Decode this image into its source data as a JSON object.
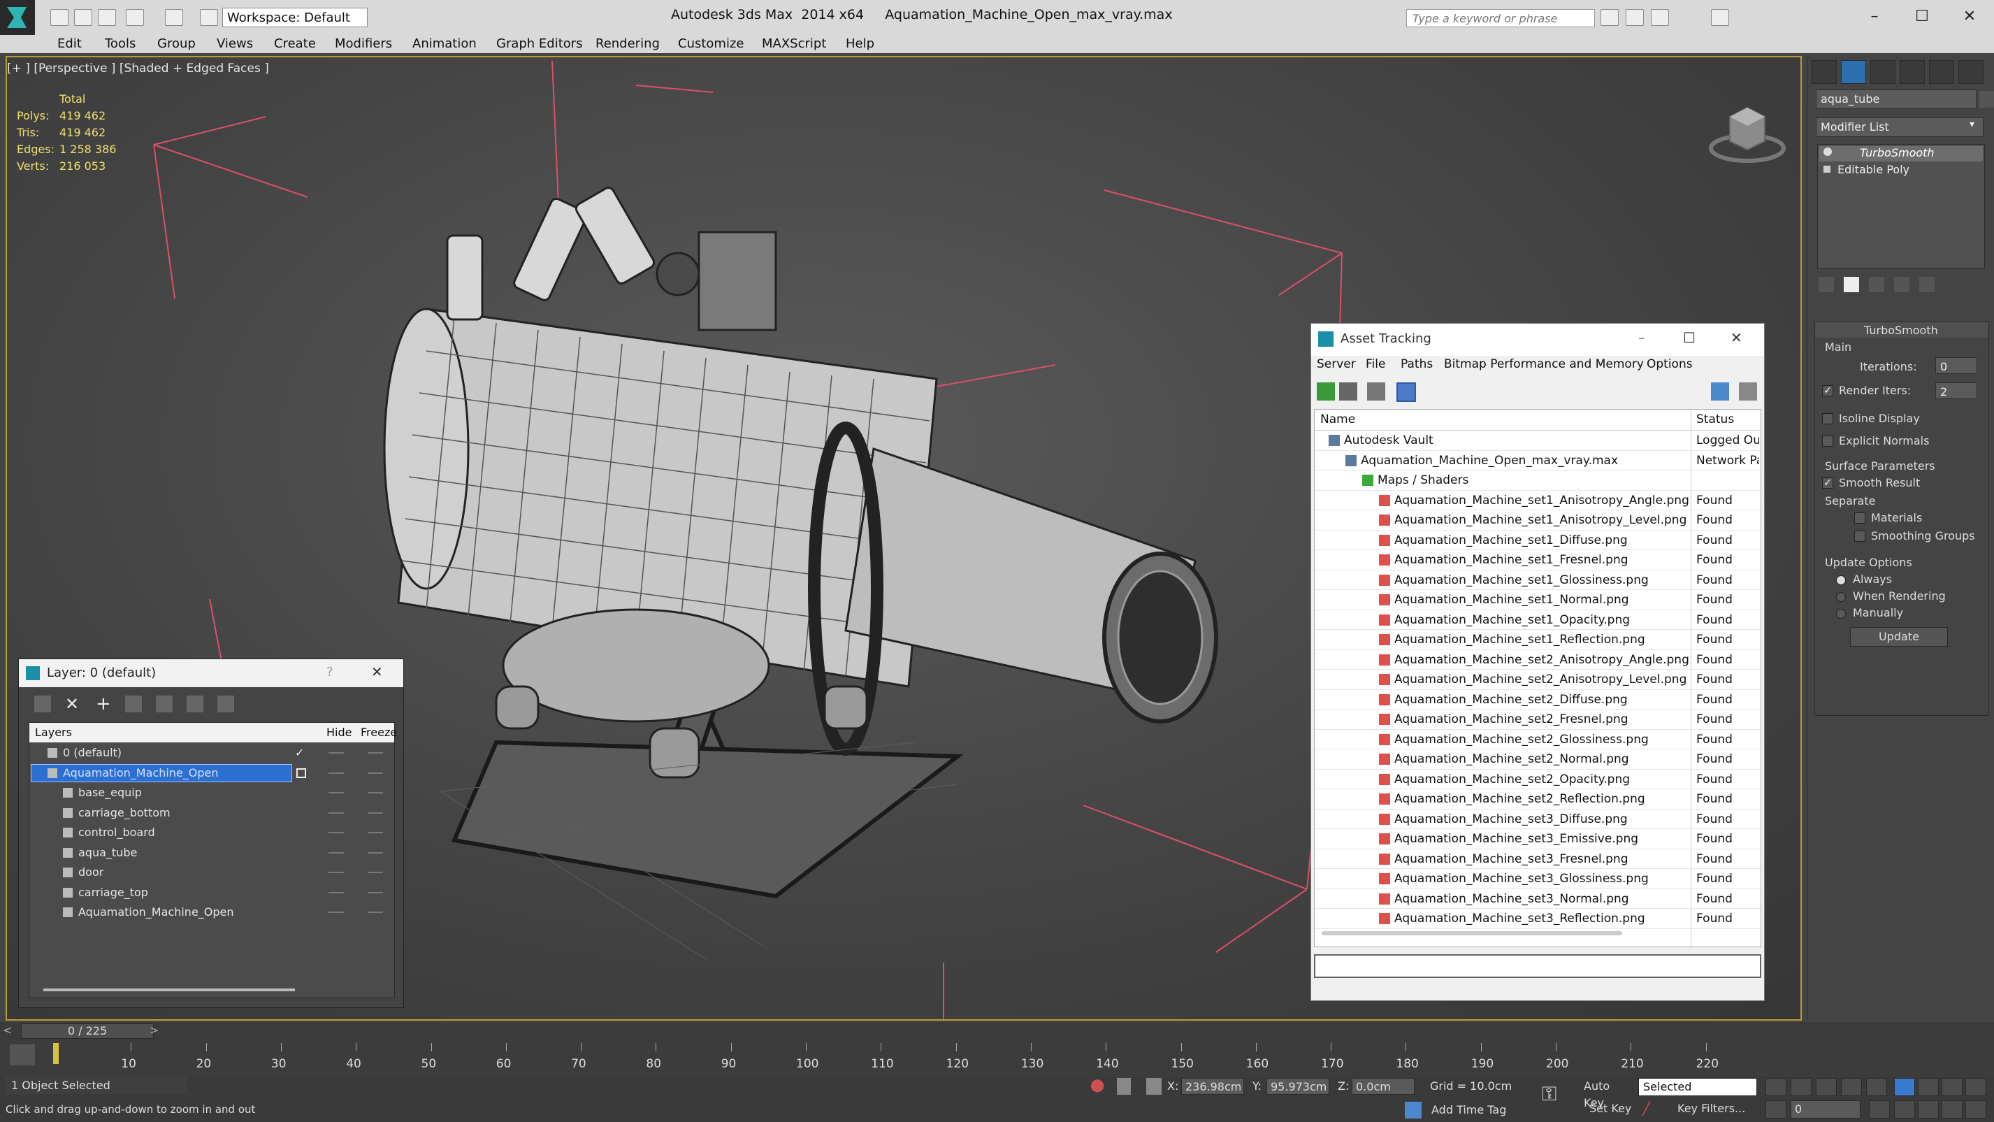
{
  "titlebar": {
    "app_title": "Autodesk 3ds Max  2014 x64     Aquamation_Machine_Open_max_vray.max",
    "workspace": "Workspace: Default",
    "search_placeholder": "Type a keyword or phrase",
    "minimize": "–",
    "maximize": "☐",
    "close": "✕"
  },
  "menu": [
    "Edit",
    "Tools",
    "Group",
    "Views",
    "Create",
    "Modifiers",
    "Animation",
    "Graph Editors",
    "Rendering",
    "Customize",
    "MAXScript",
    "Help"
  ],
  "viewport": {
    "label": "[+ ] [Perspective ] [Shaded + Edged Faces ]",
    "stats": {
      "header": "Total",
      "polys_label": "Polys:",
      "polys": "419 462",
      "tris_label": "Tris:",
      "tris": "419 462",
      "edges_label": "Edges:",
      "edges": "1 258 386",
      "verts_label": "Verts:",
      "verts": "216 053"
    }
  },
  "command_panel": {
    "object_name": "aqua_tube",
    "modifier_list": "Modifier List",
    "stack": [
      "TurboSmooth",
      "Editable Poly"
    ],
    "rollout_title": "TurboSmooth",
    "main_label": "Main",
    "iterations_label": "Iterations:",
    "iterations": "0",
    "render_iters_label": "Render Iters:",
    "render_iters": "2",
    "isoline_display": "Isoline Display",
    "explicit_normals": "Explicit Normals",
    "surface_parameters": "Surface Parameters",
    "smooth_result": "Smooth Result",
    "separate_label": "Separate",
    "materials": "Materials",
    "smoothing_groups": "Smoothing Groups",
    "update_options": "Update Options",
    "always": "Always",
    "when_rendering": "When Rendering",
    "manually": "Manually",
    "update_button": "Update"
  },
  "asset_tracking": {
    "title": "Asset Tracking",
    "menu": [
      "Server",
      "File",
      "Paths",
      "Bitmap Performance and Memory",
      "Options"
    ],
    "col_name": "Name",
    "col_status": "Status",
    "rows": [
      {
        "name": "Autodesk Vault",
        "status": "Logged Out",
        "indent": 0
      },
      {
        "name": "Aquamation_Machine_Open_max_vray.max",
        "status": "Network Pa",
        "indent": 1
      },
      {
        "name": "Maps / Shaders",
        "status": "",
        "indent": 2
      },
      {
        "name": "Aquamation_Machine_set1_Anisotropy_Angle.png",
        "status": "Found",
        "indent": 3
      },
      {
        "name": "Aquamation_Machine_set1_Anisotropy_Level.png",
        "status": "Found",
        "indent": 3
      },
      {
        "name": "Aquamation_Machine_set1_Diffuse.png",
        "status": "Found",
        "indent": 3
      },
      {
        "name": "Aquamation_Machine_set1_Fresnel.png",
        "status": "Found",
        "indent": 3
      },
      {
        "name": "Aquamation_Machine_set1_Glossiness.png",
        "status": "Found",
        "indent": 3
      },
      {
        "name": "Aquamation_Machine_set1_Normal.png",
        "status": "Found",
        "indent": 3
      },
      {
        "name": "Aquamation_Machine_set1_Opacity.png",
        "status": "Found",
        "indent": 3
      },
      {
        "name": "Aquamation_Machine_set1_Reflection.png",
        "status": "Found",
        "indent": 3
      },
      {
        "name": "Aquamation_Machine_set2_Anisotropy_Angle.png",
        "status": "Found",
        "indent": 3
      },
      {
        "name": "Aquamation_Machine_set2_Anisotropy_Level.png",
        "status": "Found",
        "indent": 3
      },
      {
        "name": "Aquamation_Machine_set2_Diffuse.png",
        "status": "Found",
        "indent": 3
      },
      {
        "name": "Aquamation_Machine_set2_Fresnel.png",
        "status": "Found",
        "indent": 3
      },
      {
        "name": "Aquamation_Machine_set2_Glossiness.png",
        "status": "Found",
        "indent": 3
      },
      {
        "name": "Aquamation_Machine_set2_Normal.png",
        "status": "Found",
        "indent": 3
      },
      {
        "name": "Aquamation_Machine_set2_Opacity.png",
        "status": "Found",
        "indent": 3
      },
      {
        "name": "Aquamation_Machine_set2_Reflection.png",
        "status": "Found",
        "indent": 3
      },
      {
        "name": "Aquamation_Machine_set3_Diffuse.png",
        "status": "Found",
        "indent": 3
      },
      {
        "name": "Aquamation_Machine_set3_Emissive.png",
        "status": "Found",
        "indent": 3
      },
      {
        "name": "Aquamation_Machine_set3_Fresnel.png",
        "status": "Found",
        "indent": 3
      },
      {
        "name": "Aquamation_Machine_set3_Glossiness.png",
        "status": "Found",
        "indent": 3
      },
      {
        "name": "Aquamation_Machine_set3_Normal.png",
        "status": "Found",
        "indent": 3
      },
      {
        "name": "Aquamation_Machine_set3_Reflection.png",
        "status": "Found",
        "indent": 3
      }
    ]
  },
  "layer_window": {
    "title": "Layer: 0 (default)",
    "help": "?",
    "close": "✕",
    "col_layers": "Layers",
    "col_hide": "Hide",
    "col_freeze": "Freeze",
    "rows": [
      {
        "name": "0 (default)",
        "indent": 0,
        "selected": false
      },
      {
        "name": "Aquamation_Machine_Open",
        "indent": 0,
        "selected": true
      },
      {
        "name": "base_equip",
        "indent": 1,
        "selected": false
      },
      {
        "name": "carriage_bottom",
        "indent": 1,
        "selected": false
      },
      {
        "name": "control_board",
        "indent": 1,
        "selected": false
      },
      {
        "name": "aqua_tube",
        "indent": 1,
        "selected": false
      },
      {
        "name": "door",
        "indent": 1,
        "selected": false
      },
      {
        "name": "carriage_top",
        "indent": 1,
        "selected": false
      },
      {
        "name": "Aquamation_Machine_Open",
        "indent": 1,
        "selected": false
      }
    ]
  },
  "timeline": {
    "frame": "0 / 225",
    "ticks": [
      "10",
      "20",
      "30",
      "40",
      "50",
      "60",
      "70",
      "80",
      "90",
      "100",
      "110",
      "120",
      "130",
      "140",
      "150",
      "160",
      "170",
      "180",
      "190",
      "200",
      "210",
      "220"
    ]
  },
  "statusbar": {
    "selected": "1 Object Selected",
    "prompt": "Click and drag up-and-down to zoom in and out",
    "x_label": "X:",
    "x": "236.98cm",
    "y_label": "Y:",
    "y": "95.973cm",
    "z_label": "Z:",
    "z": "0.0cm",
    "grid": "Grid = 10.0cm",
    "add_time_tag": "Add Time Tag",
    "auto_key": "Auto Key",
    "set_key": "Set Key",
    "selected_dropdown": "Selected",
    "key_filters": "Key Filters...",
    "frame_field": "0"
  },
  "colors": {
    "accent": "#b89c34",
    "selection": "#2d6fd0",
    "grid_line": "#d9506a"
  }
}
